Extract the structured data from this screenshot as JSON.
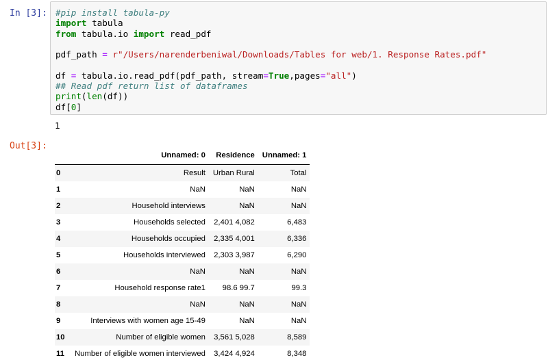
{
  "input_cell": {
    "prompt": "In [3]:",
    "lines": [
      [
        {
          "t": "#pip install tabula-py",
          "c": "c-com"
        }
      ],
      [
        {
          "t": "import",
          "c": "c-kw"
        },
        {
          "t": " tabula",
          "c": ""
        }
      ],
      [
        {
          "t": "from",
          "c": "c-kw"
        },
        {
          "t": " tabula.io ",
          "c": ""
        },
        {
          "t": "import",
          "c": "c-kw"
        },
        {
          "t": " read_pdf",
          "c": ""
        }
      ],
      [],
      [
        {
          "t": "pdf_path ",
          "c": ""
        },
        {
          "t": "=",
          "c": "c-op"
        },
        {
          "t": " r\"/Users/narenderbeniwal/Downloads/Tables for web/1. Response Rates.pdf\"",
          "c": "c-str"
        }
      ],
      [],
      [
        {
          "t": "df ",
          "c": ""
        },
        {
          "t": "=",
          "c": "c-op"
        },
        {
          "t": " tabula.io.read_pdf(pdf_path, stream",
          "c": ""
        },
        {
          "t": "=",
          "c": "c-op"
        },
        {
          "t": "True",
          "c": "c-kw"
        },
        {
          "t": ",pages",
          "c": ""
        },
        {
          "t": "=",
          "c": "c-op"
        },
        {
          "t": "\"all\"",
          "c": "c-str"
        },
        {
          "t": ")",
          "c": ""
        }
      ],
      [
        {
          "t": "## Read pdf return list of dataframes",
          "c": "c-com"
        }
      ],
      [
        {
          "t": "print",
          "c": "c-bi"
        },
        {
          "t": "(",
          "c": ""
        },
        {
          "t": "len",
          "c": "c-bi"
        },
        {
          "t": "(df))",
          "c": ""
        }
      ],
      [
        {
          "t": "df[",
          "c": ""
        },
        {
          "t": "0",
          "c": "c-num"
        },
        {
          "t": "]",
          "c": ""
        }
      ]
    ]
  },
  "stdout": "1",
  "output_cell": {
    "prompt": "Out[3]:",
    "table": {
      "columns": [
        "",
        "Unnamed: 0",
        "Residence",
        "Unnamed: 1"
      ],
      "rows": [
        [
          "0",
          "Result",
          "Urban Rural",
          "Total"
        ],
        [
          "1",
          "NaN",
          "NaN",
          "NaN"
        ],
        [
          "2",
          "Household interviews",
          "NaN",
          "NaN"
        ],
        [
          "3",
          "Households selected",
          "2,401 4,082",
          "6,483"
        ],
        [
          "4",
          "Households occupied",
          "2,335 4,001",
          "6,336"
        ],
        [
          "5",
          "Households interviewed",
          "2,303 3,987",
          "6,290"
        ],
        [
          "6",
          "NaN",
          "NaN",
          "NaN"
        ],
        [
          "7",
          "Household response rate1",
          "98.6 99.7",
          "99.3"
        ],
        [
          "8",
          "NaN",
          "NaN",
          "NaN"
        ],
        [
          "9",
          "Interviews with women age 15-49",
          "NaN",
          "NaN"
        ],
        [
          "10",
          "Number of eligible women",
          "3,561 5,028",
          "8,589"
        ],
        [
          "11",
          "Number of eligible women interviewed",
          "3,424 4,924",
          "8,348"
        ]
      ]
    }
  }
}
